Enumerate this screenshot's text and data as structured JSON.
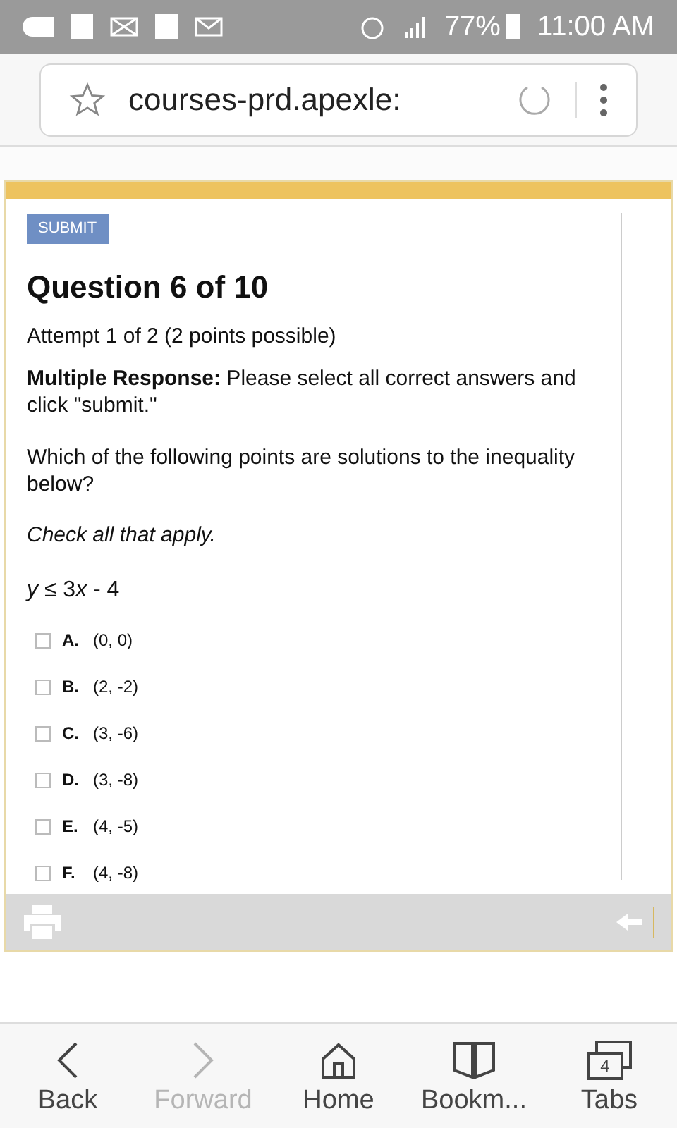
{
  "status_bar": {
    "battery": "77%",
    "time": "11:00 AM"
  },
  "address_bar": {
    "url": "courses-prd.apexle:"
  },
  "quiz": {
    "submit": "SUBMIT",
    "title": "Question 6 of 10",
    "attempt": "Attempt 1 of 2 (2 points possible)",
    "instructions": "**Multiple Response:** Please select all correct answers and click \"submit.\"",
    "question": "Which of the following points are solutions to the inequality below?",
    "hint": "Check all that apply.",
    "equation": [
      {
        "text": "y",
        "italic": true
      },
      {
        "text": " ≤ 3",
        "italic": false
      },
      {
        "text": "x",
        "italic": true
      },
      {
        "text": " - 4",
        "italic": false
      }
    ],
    "options": [
      {
        "letter": "A.",
        "text": "(0, 0)",
        "checked": false
      },
      {
        "letter": "B.",
        "text": "(2, -2)",
        "checked": false
      },
      {
        "letter": "C.",
        "text": "(3, -6)",
        "checked": false
      },
      {
        "letter": "D.",
        "text": "(3, -8)",
        "checked": false
      },
      {
        "letter": "E.",
        "text": "(4, -5)",
        "checked": false
      },
      {
        "letter": "F.",
        "text": "(4, -8)",
        "checked": false
      }
    ]
  },
  "bottom_nav": [
    {
      "kind": "back",
      "label": "Back",
      "disabled": false
    },
    {
      "kind": "forward",
      "label": "Forward",
      "disabled": true
    },
    {
      "kind": "home",
      "label": "Home",
      "disabled": false
    },
    {
      "kind": "bookmarks",
      "label": "Bookm...",
      "disabled": false
    },
    {
      "kind": "tabs",
      "label": "Tabs",
      "disabled": false,
      "count": "4"
    }
  ]
}
